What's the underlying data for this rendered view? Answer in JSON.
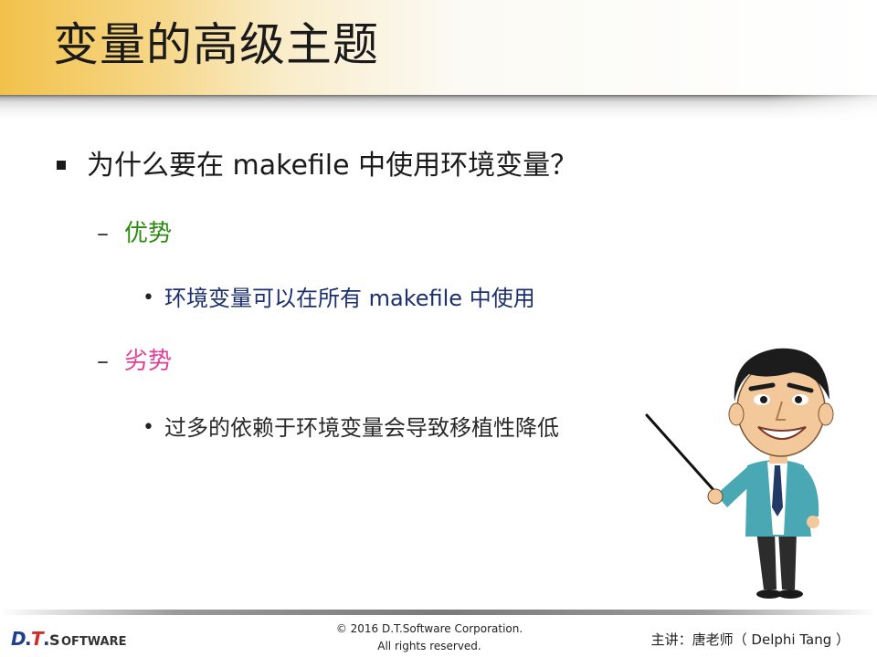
{
  "slide": {
    "title": "变量的高级主题",
    "bullets": {
      "level1_text": "为什么要在 makefile 中使用环境变量？",
      "advantage_label": "优势",
      "advantage_item": "环境变量可以在所有 makefile 中使用",
      "disadvantage_label": "劣势",
      "disadvantage_item": "过多的依赖于环境变量会导致移植性降低",
      "dash_glyph": "–",
      "dot_glyph": "•"
    }
  },
  "footer": {
    "logo_text": "D.T.SOFTWARE",
    "copyright_line1": "© 2016 D.T.Software Corporation.",
    "copyright_line2": "All rights reserved.",
    "lecturer": "主讲：唐老师（ Delphi Tang ）"
  },
  "colors": {
    "title_gold": "#f2c14a",
    "advantage": "#2e8b12",
    "disadvantage": "#e0409a",
    "advantage_item": "#1c2f6e",
    "logo_blue": "#1f3f8f",
    "logo_red": "#d42a2a"
  },
  "illustrations": {
    "teacher": "cartoon-teacher-with-pointer"
  }
}
